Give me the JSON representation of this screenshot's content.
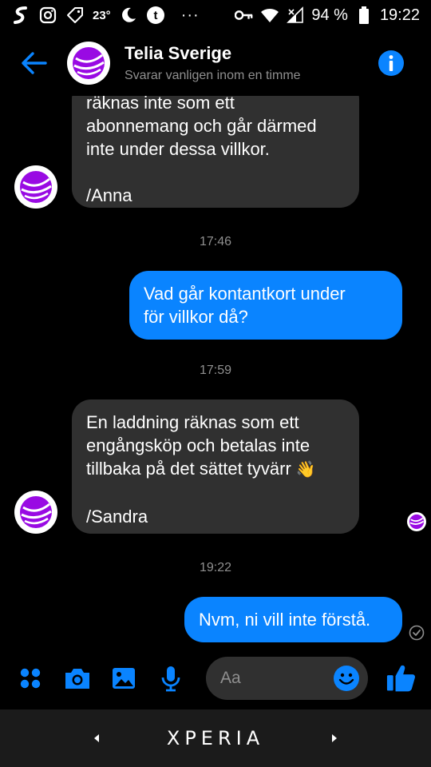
{
  "status_bar": {
    "temperature": "23°",
    "dots": "···",
    "battery": "94 %",
    "time": "19:22",
    "icons": [
      "s-app-icon",
      "instagram-icon",
      "tag-icon",
      "temperature-icon",
      "moon-icon",
      "tumblr-icon",
      "key-icon",
      "wifi-icon",
      "signal-icon",
      "battery-icon"
    ]
  },
  "header": {
    "title": "Telia Sverige",
    "subtitle": "Svarar vanligen inom en timme",
    "accent": "#0a84ff",
    "brand_purple": "#990ae3"
  },
  "messages": [
    {
      "type": "incoming",
      "lines": [
        "räknas inte som ett",
        "abonnemang och går därmed",
        "inte under dessa villkor."
      ],
      "signature": "/Anna"
    },
    {
      "type": "timestamp",
      "text": "17:46"
    },
    {
      "type": "outgoing",
      "lines": [
        "Vad går kontantkort under",
        "för villkor då?"
      ]
    },
    {
      "type": "timestamp",
      "text": "17:59"
    },
    {
      "type": "incoming",
      "lines": [
        "En laddning räknas som ett",
        "engångsköp och betalas inte",
        "tillbaka på det sättet tyvärr"
      ],
      "emoji": "👋",
      "signature": "/Sandra"
    },
    {
      "type": "timestamp",
      "text": "19:22"
    },
    {
      "type": "outgoing",
      "lines": [
        "Nvm, ni vill inte förstå."
      ]
    }
  ],
  "composer": {
    "placeholder": "Aa",
    "icons": [
      "apps-icon",
      "camera-icon",
      "gallery-icon",
      "microphone-icon",
      "emoji-icon",
      "thumbs-up-icon"
    ]
  },
  "navbar": {
    "brand": "XPERIA"
  },
  "colors": {
    "background": "#000000",
    "incoming_bubble": "#303030",
    "outgoing_bubble": "#0a84ff",
    "muted_text": "#8f8f8f"
  }
}
